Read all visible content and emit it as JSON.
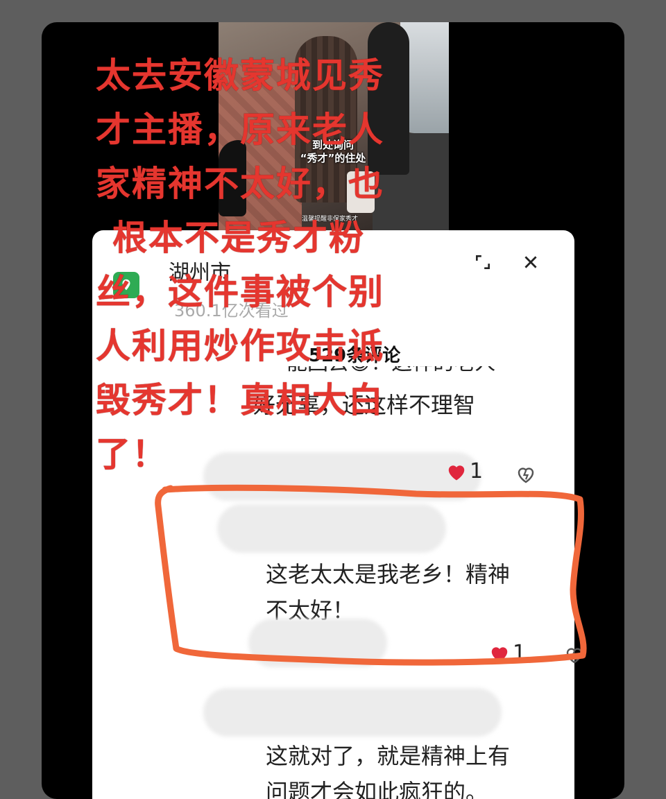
{
  "video": {
    "caption_line1": "到处询问",
    "caption_line2": "“秀才”的住处",
    "subtitle": "温馨提醒非保家秀才"
  },
  "overlay": {
    "lines": [
      "太去安徽蒙城见秀",
      "才主播，原来老人",
      "家精神不太好，也",
      "根本不是秀才粉",
      "丝，这件事被个别",
      "人利用炒作攻击诋",
      "毁秀才！真相大白",
      "了！"
    ],
    "color": "#e5362f"
  },
  "panel": {
    "location": "湖州市",
    "views": "360.1亿次看过",
    "comment_count": "529条评论",
    "icons": [
      "location-icon",
      "expand-icon",
      "close-icon",
      "heart-icon",
      "dislike-icon"
    ]
  },
  "comments": [
    {
      "text_partial": "能回去😄！这样的老人",
      "text": "好无辜，还这样不理智",
      "likes": "1"
    },
    {
      "text": "这老太太是我老乡！精神不太好！",
      "text_line1": "这老太太是我老乡！精神",
      "text_line2": "不太好！",
      "likes": "1",
      "highlight_color": "#f0673a"
    },
    {
      "text_line1": "这就对了，就是精神上有",
      "text_line2": "问题才会如此疯狂的。"
    }
  ]
}
